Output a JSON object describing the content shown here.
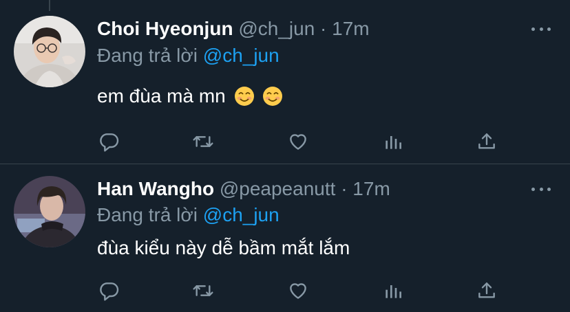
{
  "tweets": [
    {
      "name": "Choi Hyeonjun",
      "handle": "@ch_jun",
      "separator": "·",
      "time": "17m",
      "reply_prefix": "Đang trả lời",
      "reply_mention": "@ch_jun",
      "text": "em đùa mà mn",
      "emojis": [
        "smiling-face-icon",
        "smiling-face-icon"
      ]
    },
    {
      "name": "Han Wangho",
      "handle": "@peapeanutt",
      "separator": "·",
      "time": "17m",
      "reply_prefix": "Đang trả lời",
      "reply_mention": "@ch_jun",
      "text": "đùa kiểu này dễ bầm mắt lắm"
    }
  ],
  "icons": {
    "actions": [
      "reply-icon",
      "retweet-icon",
      "like-icon",
      "analytics-icon",
      "share-icon"
    ],
    "more": "more-options-icon"
  },
  "colors": {
    "background": "#15202b",
    "secondary_text": "#8899a6",
    "accent": "#1da1f2",
    "divider": "#38444d"
  }
}
